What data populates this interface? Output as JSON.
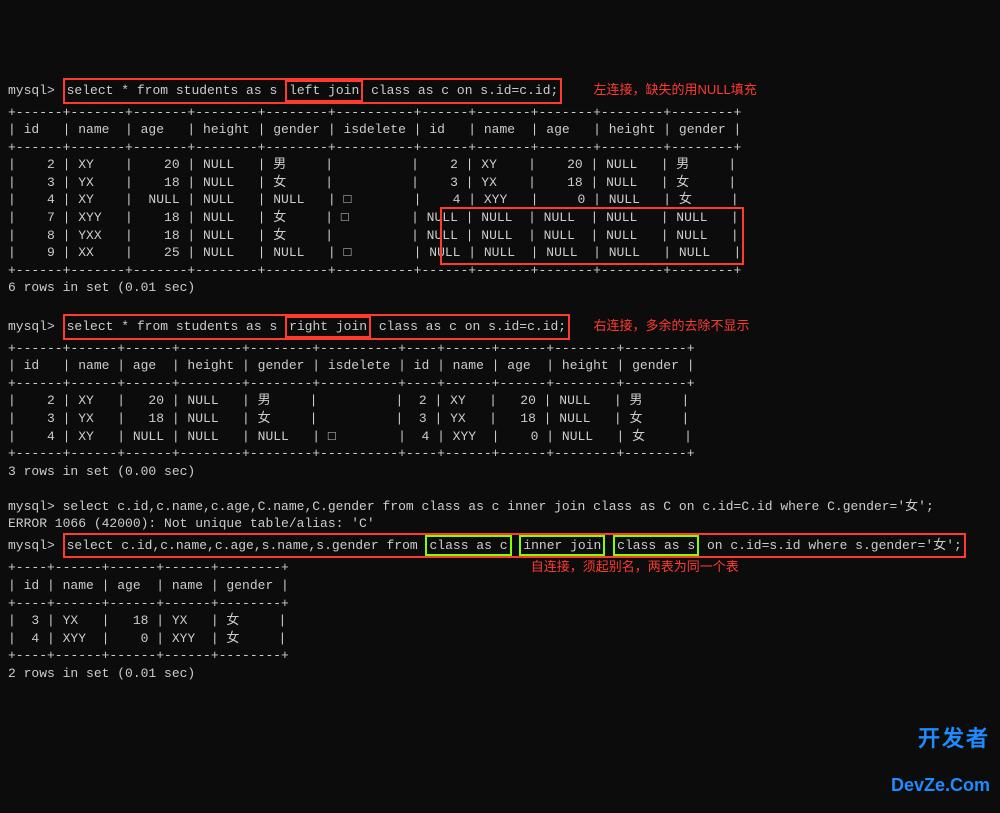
{
  "prompt": "mysql>",
  "query1": {
    "pre": "select * from students as s ",
    "join_kw": "left join",
    "post": " class as c on s.id=c.id;",
    "annotation": "左连接，缺失的用NULL填充",
    "divider": "+------+-------+-------+--------+--------+----------+------+-------+-------+--------+--------+",
    "headers": "| id   | name  | age   | height | gender | isdelete | id   | name  | age   | height | gender |",
    "rows": [
      "|    2 | XY    |    20 | NULL   | 男     |          |    2 | XY    |    20 | NULL   | 男     |",
      "|    3 | YX    |    18 | NULL   | 女     |          |    3 | YX    |    18 | NULL   | 女     |",
      "|    4 | XY    |  NULL | NULL   | NULL   | □        |    4 | XYY   |     0 | NULL   | 女     |",
      "|    7 | XYY   |    18 | NULL   | 女     | □        | NULL | NULL  | NULL  | NULL   | NULL   |",
      "|    8 | YXX   |    18 | NULL   | 女     |          | NULL | NULL  | NULL  | NULL   | NULL   |",
      "|    9 | XX    |    25 | NULL   | NULL   | □        | NULL | NULL  | NULL  | NULL   | NULL   |"
    ],
    "footer": "6 rows in set (0.01 sec)"
  },
  "query2": {
    "pre": "select * from students as s ",
    "join_kw": "right join",
    "post": " class as c on s.id=c.id;",
    "annotation": "右连接，多余的去除不显示",
    "divider": "+------+------+------+--------+--------+----------+----+------+------+--------+--------+",
    "headers": "| id   | name | age  | height | gender | isdelete | id | name | age  | height | gender |",
    "rows": [
      "|    2 | XY   |   20 | NULL   | 男     |          |  2 | XY   |   20 | NULL   | 男     |",
      "|    3 | YX   |   18 | NULL   | 女     |          |  3 | YX   |   18 | NULL   | 女     |",
      "|    4 | XY   | NULL | NULL   | NULL   | □        |  4 | XYY  |    0 | NULL   | 女     |"
    ],
    "footer": "3 rows in set (0.00 sec)"
  },
  "query3": {
    "line": "mysql> select c.id,c.name,c.age,C.name,C.gender from class as c inner join class as C on c.id=C.id where C.gender='女';",
    "error": "ERROR 1066 (42000): Not unique table/alias: 'C'"
  },
  "query4": {
    "pre": "select c.id,c.name,c.age,s.name,s.gender from ",
    "seg1": "class as c",
    "seg2": "inner join",
    "seg3": "class as s",
    "post": " on c.id=s.id where s.gender='女';",
    "annotation": "自连接，须起别名，两表为同一个表",
    "divider": "+----+------+------+------+--------+",
    "headers": "| id | name | age  | name | gender |",
    "rows": [
      "|  3 | YX   |   18 | YX   | 女     |",
      "|  4 | XYY  |    0 | XYY  | 女     |"
    ],
    "footer": "2 rows in set (0.01 sec)"
  },
  "watermark": {
    "line1": "开发者",
    "line2": "DevZe.Com"
  },
  "chart_data": {
    "type": "table",
    "tables": [
      {
        "title": "LEFT JOIN students s, class c ON s.id=c.id",
        "columns": [
          "s.id",
          "s.name",
          "s.age",
          "s.height",
          "s.gender",
          "s.isdelete",
          "c.id",
          "c.name",
          "c.age",
          "c.height",
          "c.gender"
        ],
        "rows": [
          [
            2,
            "XY",
            20,
            null,
            "男",
            null,
            2,
            "XY",
            20,
            null,
            "男"
          ],
          [
            3,
            "YX",
            18,
            null,
            "女",
            null,
            3,
            "YX",
            18,
            null,
            "女"
          ],
          [
            4,
            "XY",
            null,
            null,
            null,
            "□",
            4,
            "XYY",
            0,
            null,
            "女"
          ],
          [
            7,
            "XYY",
            18,
            null,
            "女",
            "□",
            null,
            null,
            null,
            null,
            null
          ],
          [
            8,
            "YXX",
            18,
            null,
            "女",
            null,
            null,
            null,
            null,
            null,
            null
          ],
          [
            9,
            "XX",
            25,
            null,
            null,
            "□",
            null,
            null,
            null,
            null,
            null
          ]
        ]
      },
      {
        "title": "RIGHT JOIN students s, class c ON s.id=c.id",
        "columns": [
          "s.id",
          "s.name",
          "s.age",
          "s.height",
          "s.gender",
          "s.isdelete",
          "c.id",
          "c.name",
          "c.age",
          "c.height",
          "c.gender"
        ],
        "rows": [
          [
            2,
            "XY",
            20,
            null,
            "男",
            null,
            2,
            "XY",
            20,
            null,
            "男"
          ],
          [
            3,
            "YX",
            18,
            null,
            "女",
            null,
            3,
            "YX",
            18,
            null,
            "女"
          ],
          [
            4,
            "XY",
            null,
            null,
            null,
            "□",
            4,
            "XYY",
            0,
            null,
            "女"
          ]
        ]
      },
      {
        "title": "SELF INNER JOIN class c, class s ON c.id=s.id WHERE s.gender='女'",
        "columns": [
          "c.id",
          "c.name",
          "c.age",
          "s.name",
          "s.gender"
        ],
        "rows": [
          [
            3,
            "YX",
            18,
            "YX",
            "女"
          ],
          [
            4,
            "XYY",
            0,
            "XYY",
            "女"
          ]
        ]
      }
    ]
  }
}
